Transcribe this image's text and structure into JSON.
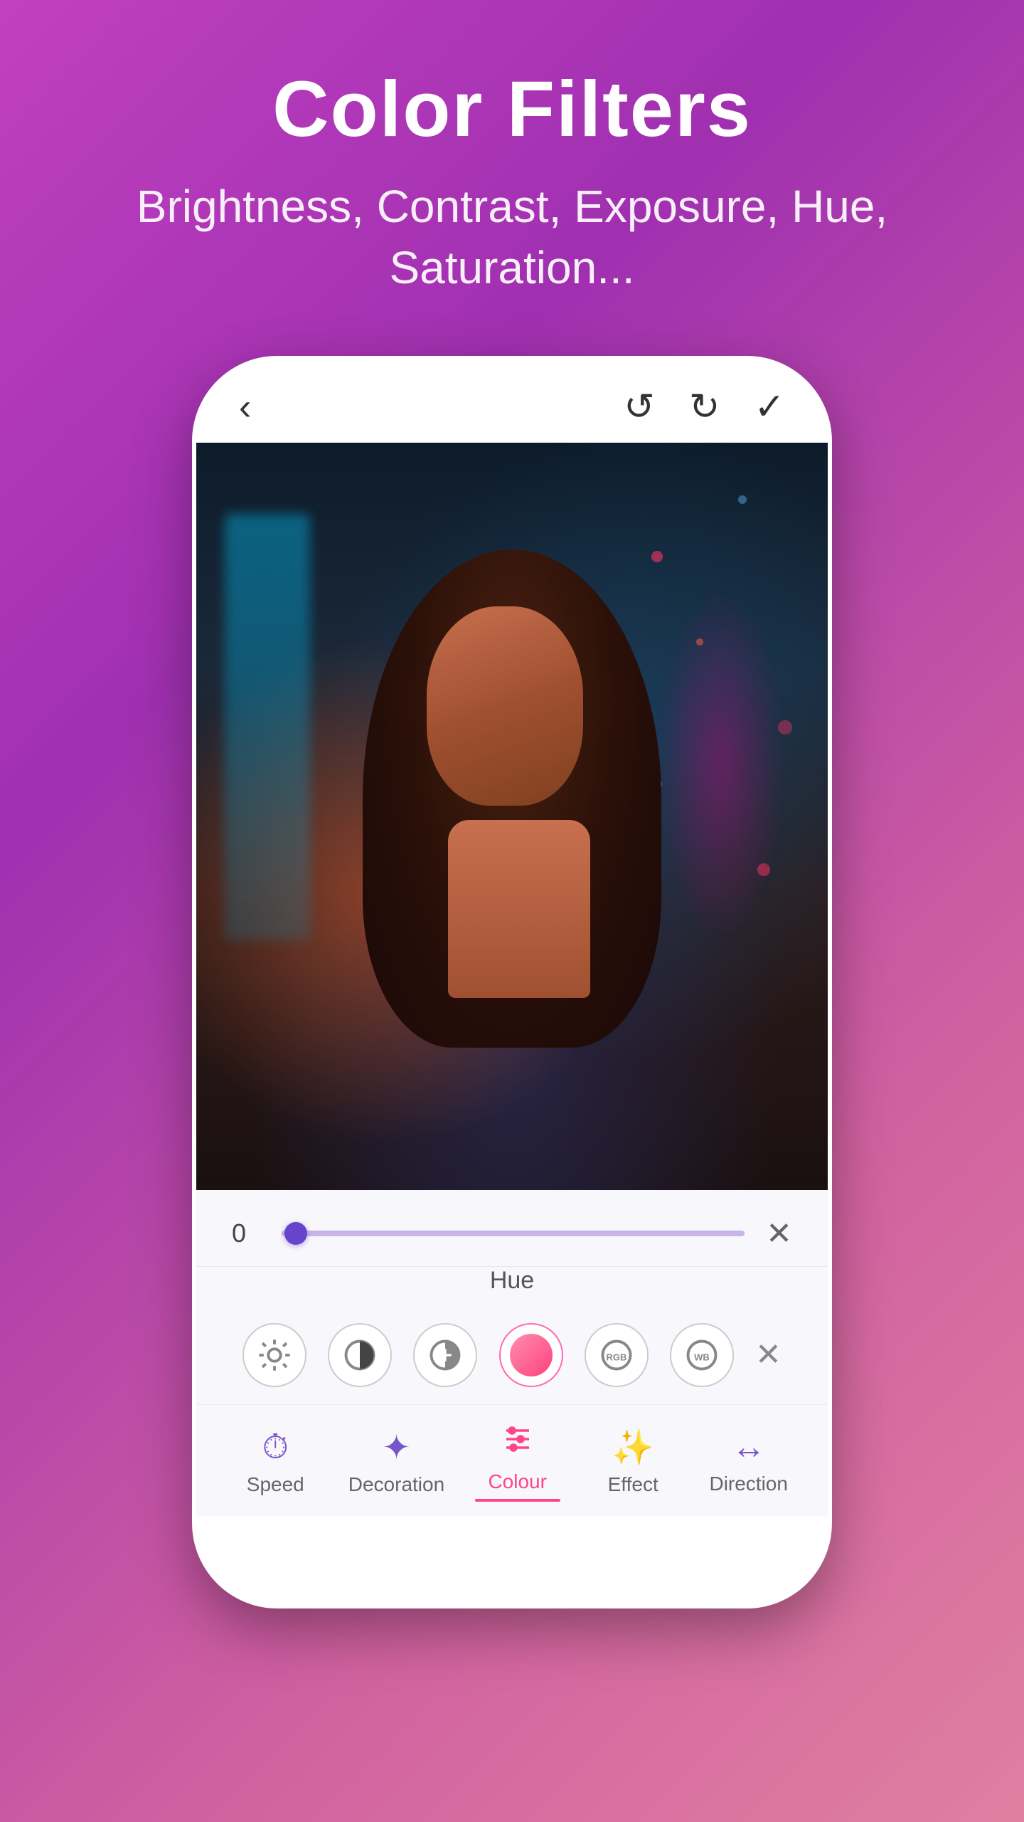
{
  "header": {
    "title": "Color Filters",
    "subtitle": "Brightness, Contrast, Exposure, Hue, Saturation..."
  },
  "phone": {
    "nav": {
      "back_icon": "‹",
      "undo_icon": "↺",
      "redo_icon": "↻",
      "confirm_icon": "✓"
    },
    "slider": {
      "value": "0",
      "label": "Hue",
      "close_icon": "✕"
    },
    "filter_icons": [
      {
        "name": "brightness",
        "label": "brightness-icon"
      },
      {
        "name": "contrast",
        "label": "contrast-icon"
      },
      {
        "name": "exposure",
        "label": "exposure-icon"
      },
      {
        "name": "hue",
        "label": "hue-icon"
      },
      {
        "name": "rgb",
        "label": "rgb-icon",
        "text": "RGB"
      },
      {
        "name": "wb",
        "label": "wb-icon",
        "text": "WB"
      },
      {
        "name": "close",
        "label": "close-icon"
      }
    ],
    "bottom_nav": [
      {
        "id": "speed",
        "label": "Speed",
        "icon": "⏱",
        "active": false
      },
      {
        "id": "decoration",
        "label": "Decoration",
        "icon": "✦",
        "active": false
      },
      {
        "id": "colour",
        "label": "Colour",
        "icon": "≡",
        "active": true
      },
      {
        "id": "effect",
        "label": "Effect",
        "icon": "✨",
        "active": false
      },
      {
        "id": "direction",
        "label": "Direction",
        "icon": "↔",
        "active": false
      }
    ]
  }
}
